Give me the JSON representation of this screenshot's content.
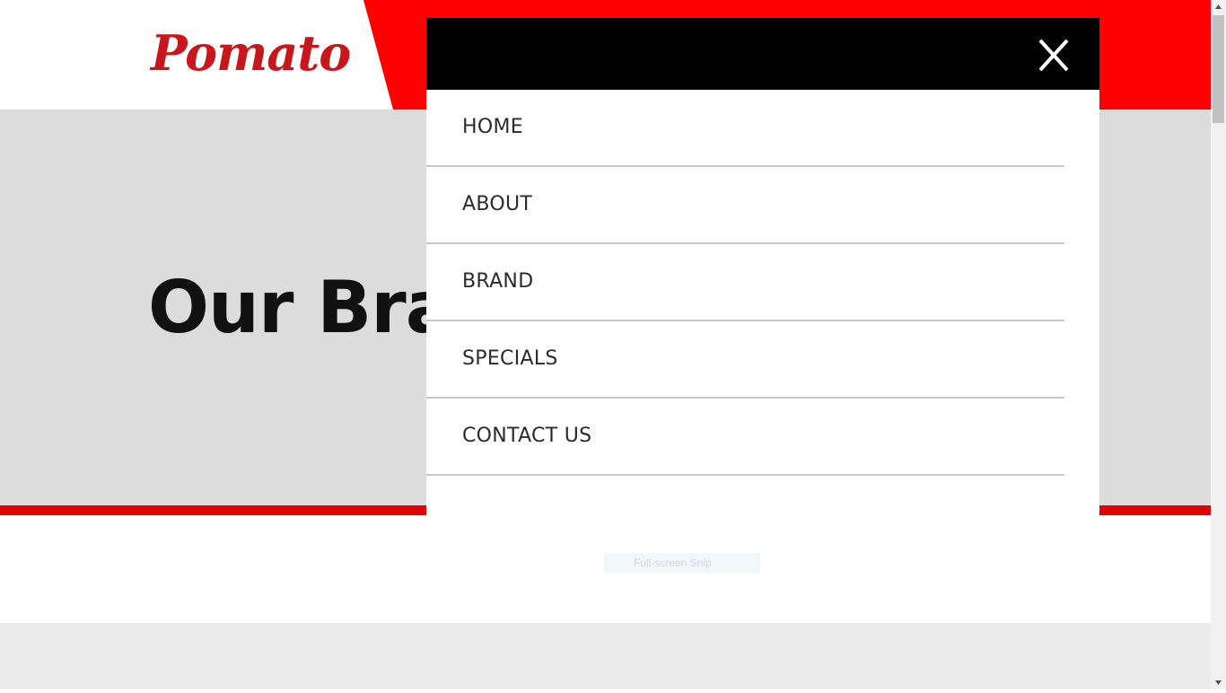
{
  "header": {
    "logo_text": "Pomato",
    "brand_red": "#ff0000",
    "logo_color": "#c8161d"
  },
  "hero": {
    "title": "Our Bra",
    "background": "#dcdcdc",
    "bar_color": "#e00000"
  },
  "menu": {
    "close_icon": "close-icon",
    "close_label": "X",
    "items": [
      {
        "label": "HOME"
      },
      {
        "label": "ABOUT"
      },
      {
        "label": "BRAND"
      },
      {
        "label": "SPECIALS"
      },
      {
        "label": "CONTACT US"
      }
    ]
  },
  "overlay_hint": {
    "text": "Full-screen Snip"
  },
  "scrollbar": {
    "up_icon": "scroll-up-arrow-icon",
    "down_icon": "scroll-down-arrow-icon"
  }
}
